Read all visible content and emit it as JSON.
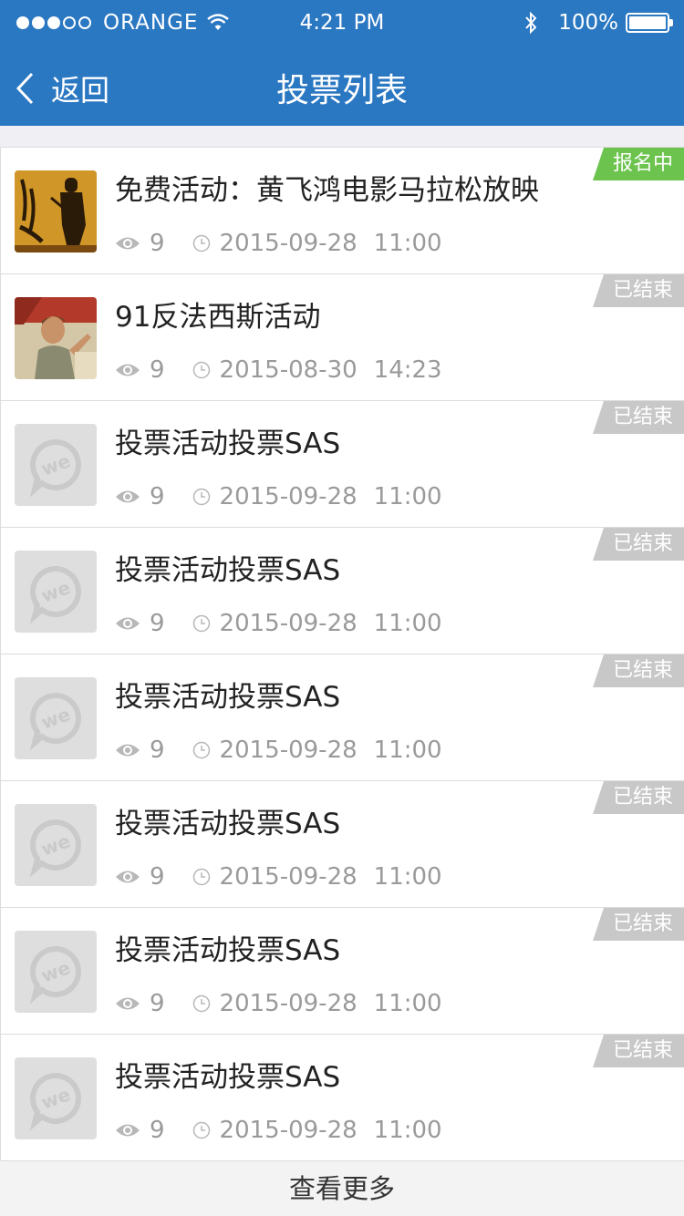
{
  "status_bar": {
    "carrier": "ORANGE",
    "time": "4:21 PM",
    "battery": "100%"
  },
  "nav": {
    "back_label": "返回",
    "title": "投票列表"
  },
  "items": [
    {
      "title": "免费活动：黄飞鸿电影马拉松放映",
      "views": "9",
      "date": "2015-09-28",
      "time": "11:00",
      "badge": "报名中",
      "badge_type": "active",
      "thumb": "movie-poster"
    },
    {
      "title": "91反法西斯活动",
      "views": "9",
      "date": "2015-08-30",
      "time": "14:23",
      "badge": "已结束",
      "badge_type": "ended",
      "thumb": "propaganda-poster"
    },
    {
      "title": "投票活动投票SAS",
      "views": "9",
      "date": "2015-09-28",
      "time": "11:00",
      "badge": "已结束",
      "badge_type": "ended",
      "thumb": "placeholder"
    },
    {
      "title": "投票活动投票SAS",
      "views": "9",
      "date": "2015-09-28",
      "time": "11:00",
      "badge": "已结束",
      "badge_type": "ended",
      "thumb": "placeholder"
    },
    {
      "title": "投票活动投票SAS",
      "views": "9",
      "date": "2015-09-28",
      "time": "11:00",
      "badge": "已结束",
      "badge_type": "ended",
      "thumb": "placeholder"
    },
    {
      "title": "投票活动投票SAS",
      "views": "9",
      "date": "2015-09-28",
      "time": "11:00",
      "badge": "已结束",
      "badge_type": "ended",
      "thumb": "placeholder"
    },
    {
      "title": "投票活动投票SAS",
      "views": "9",
      "date": "2015-09-28",
      "time": "11:00",
      "badge": "已结束",
      "badge_type": "ended",
      "thumb": "placeholder"
    },
    {
      "title": "投票活动投票SAS",
      "views": "9",
      "date": "2015-09-28",
      "time": "11:00",
      "badge": "已结束",
      "badge_type": "ended",
      "thumb": "placeholder"
    }
  ],
  "more_label": "查看更多",
  "colors": {
    "header": "#2a77c2",
    "active_badge": "#6cc34e",
    "ended_badge": "#c8c8c8"
  },
  "icons": {
    "back": "chevron-left-icon",
    "views": "eye-icon",
    "time": "clock-icon"
  }
}
